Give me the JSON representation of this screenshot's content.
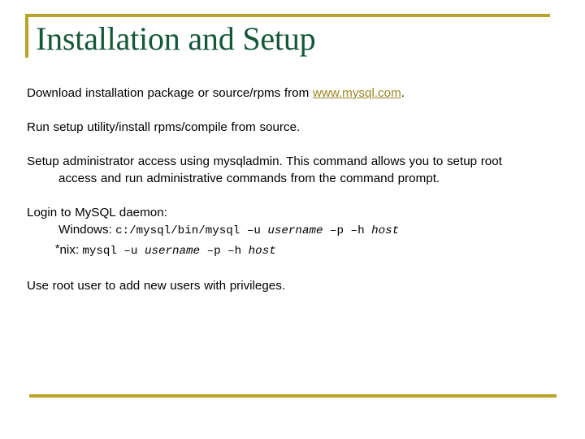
{
  "slide": {
    "title": "Installation and Setup",
    "theme": {
      "accent_gold": "#b8a42b",
      "title_green": "#14573a",
      "link_gold": "#9c8526",
      "body_black": "#000000",
      "background": "#ffffff"
    },
    "bullets": {
      "download": {
        "text_before_link": "Download installation package or source/rpms from ",
        "link_label": "www.mysql.com",
        "text_after_link": "."
      },
      "run_setup": "Run setup utility/install rpms/compile from source.",
      "admin_access": "Setup administrator access using mysqladmin.  This command allows you to setup root access and run administrative commands from the command prompt.",
      "login_heading": "Login to MySQL daemon:",
      "windows": {
        "label": "Windows: ",
        "command_plain_1": "c:/mysql/bin/mysql –u ",
        "command_italic_1": "username",
        "command_plain_2": " –p –h ",
        "command_italic_2": "host"
      },
      "nix": {
        "label_star": "*",
        "label": "nix: ",
        "command_plain_1": "mysql –u ",
        "command_italic_1": "username",
        "command_plain_2": " –p –h ",
        "command_italic_2": "host"
      },
      "root_user": "Use root user to add new users with privileges."
    }
  }
}
